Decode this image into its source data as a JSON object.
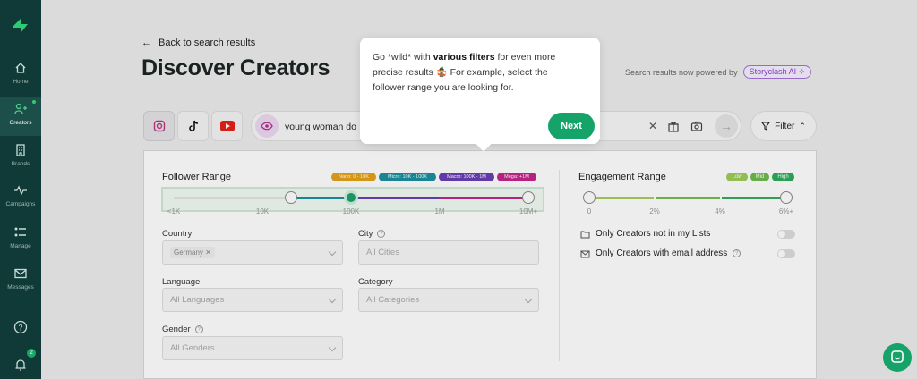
{
  "sidebar": {
    "items": [
      {
        "label": "Home",
        "icon": "home-icon"
      },
      {
        "label": "Creators",
        "icon": "users-icon",
        "active": true
      },
      {
        "label": "Brands",
        "icon": "building-icon"
      },
      {
        "label": "Campaigns",
        "icon": "pulse-icon"
      },
      {
        "label": "Manage",
        "icon": "list-icon"
      },
      {
        "label": "Messages",
        "icon": "mail-icon"
      }
    ],
    "help_icon": "help-icon",
    "notifications_badge": "2"
  },
  "header": {
    "back_label": "Back to search results",
    "title": "Discover Creators",
    "powered_text": "Search results now powered by",
    "ai_badge": "Storyclash AI ✧"
  },
  "search": {
    "platforms": [
      "instagram",
      "tiktok",
      "youtube"
    ],
    "query": "young woman do",
    "filter_label": "Filter"
  },
  "tooltip": {
    "line1_a": "Go *wild* with ",
    "line1_bold": "various filters",
    "line1_b": " for even more",
    "line2": "precise results 🤹 For example, select the",
    "line3": "follower range you are looking for.",
    "next_label": "Next"
  },
  "follower_range": {
    "title": "Follower Range",
    "badges": [
      {
        "label": "Nano: 0 - 10K",
        "color": "#e3a21a"
      },
      {
        "label": "Micro: 10K - 100K",
        "color": "#1a8fa0"
      },
      {
        "label": "Macro: 100K - 1M",
        "color": "#6a3fb5"
      },
      {
        "label": "Mega: +1M",
        "color": "#c2268a"
      }
    ],
    "ticks": [
      "<1K",
      "10K",
      "100K",
      "1M",
      "10M+"
    ],
    "selected_min": "10K",
    "selected_max": "10M+"
  },
  "filters": {
    "country_label": "Country",
    "country_chip": "Germany",
    "city_label": "City",
    "city_placeholder": "All Cities",
    "language_label": "Language",
    "language_placeholder": "All Languages",
    "category_label": "Category",
    "category_placeholder": "All Categories",
    "gender_label": "Gender",
    "gender_placeholder": "All Genders"
  },
  "engagement": {
    "title": "Engagement Range",
    "badges": [
      {
        "label": "Low",
        "color": "#9ccc5a"
      },
      {
        "label": "Mid",
        "color": "#6dbb4c"
      },
      {
        "label": "High",
        "color": "#2faa5a"
      }
    ],
    "ticks": [
      "0",
      "2%",
      "4%",
      "6%+"
    ],
    "toggle1": "Only Creators not in my Lists",
    "toggle2": "Only Creators with email address"
  }
}
